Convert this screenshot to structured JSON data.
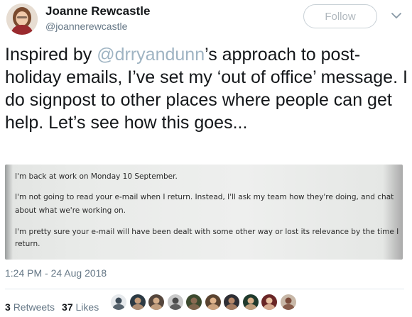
{
  "user": {
    "name": "Joanne Rewcastle",
    "handle": "@joannerewcastle"
  },
  "follow_label": "Follow",
  "tweet": {
    "before": "Inspired by ",
    "mention": "@drryandunn",
    "after": "’s approach to post-holiday emails, I’ve set my ‘out of office’ message. I do signpost to other places where people can get help. Let’s see how this goes..."
  },
  "photo_text": {
    "line1": "I'm back at work on Monday 10 September.",
    "line2a": "I'm not going to read your e-mail when I return. Instead, I'll ask my team how they're doing, and chat",
    "line2b": "about what we're working on.",
    "line3a": "I'm pretty sure your e-mail will have been dealt with some other way or lost its relevance by the time I",
    "line3b": "return."
  },
  "timestamp": "1:24 PM - 24 Aug 2018",
  "stats": {
    "retweets_count": "3",
    "retweets_label": "Retweets",
    "likes_count": "37",
    "likes_label": "Likes"
  },
  "colors": {
    "mention": "#9fb4c3",
    "secondary_text": "#657786"
  },
  "likers": [
    {
      "icon": "avatar-1",
      "bg": "#e6e9ec",
      "fg": "#3d4b57"
    },
    {
      "icon": "avatar-2",
      "bg": "#2c3a44",
      "fg": "#c59c7a"
    },
    {
      "icon": "avatar-3",
      "bg": "#55463c",
      "fg": "#d5ae8a"
    },
    {
      "icon": "avatar-4",
      "bg": "#c9c9c9",
      "fg": "#4a4a4a"
    },
    {
      "icon": "avatar-5",
      "bg": "#3c4a2e",
      "fg": "#8a6a52"
    },
    {
      "icon": "avatar-6",
      "bg": "#5a4330",
      "fg": "#e0b48c"
    },
    {
      "icon": "avatar-7",
      "bg": "#2e2e34",
      "fg": "#b7886a"
    },
    {
      "icon": "avatar-8",
      "bg": "#1f3a2c",
      "fg": "#d9b08b"
    },
    {
      "icon": "avatar-9",
      "bg": "#6a2626",
      "fg": "#e9c2a2"
    },
    {
      "icon": "avatar-10",
      "bg": "#c8b8a8",
      "fg": "#7a4a3a"
    }
  ]
}
